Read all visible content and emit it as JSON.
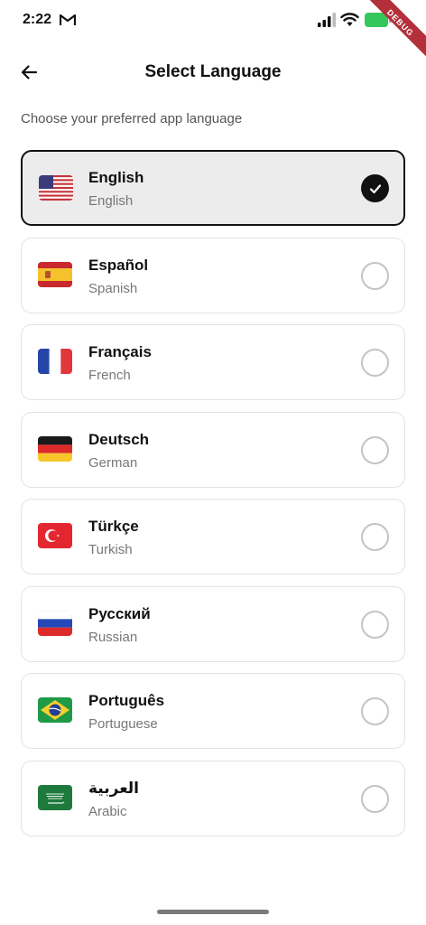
{
  "status_bar": {
    "time": "2:22"
  },
  "debug_banner": "DEBUG",
  "header": {
    "title": "Select Language"
  },
  "subtitle": "Choose your preferred app language",
  "languages": [
    {
      "native": "English",
      "english": "English",
      "flag": "us-flag-icon",
      "selected": true
    },
    {
      "native": "Español",
      "english": "Spanish",
      "flag": "spain-flag-icon",
      "selected": false
    },
    {
      "native": "Français",
      "english": "French",
      "flag": "france-flag-icon",
      "selected": false
    },
    {
      "native": "Deutsch",
      "english": "German",
      "flag": "germany-flag-icon",
      "selected": false
    },
    {
      "native": "Türkçe",
      "english": "Turkish",
      "flag": "turkey-flag-icon",
      "selected": false
    },
    {
      "native": "Русский",
      "english": "Russian",
      "flag": "russia-flag-icon",
      "selected": false
    },
    {
      "native": "Português",
      "english": "Portuguese",
      "flag": "brazil-flag-icon",
      "selected": false
    },
    {
      "native": "العربية",
      "english": "Arabic",
      "flag": "saudi-arabia-flag-icon",
      "selected": false
    }
  ],
  "colors": {
    "selected_border": "#111111",
    "selected_background": "#ececec",
    "card_border": "#e3e3e3",
    "battery": "#34c759",
    "debug_ribbon": "#b3303a"
  }
}
